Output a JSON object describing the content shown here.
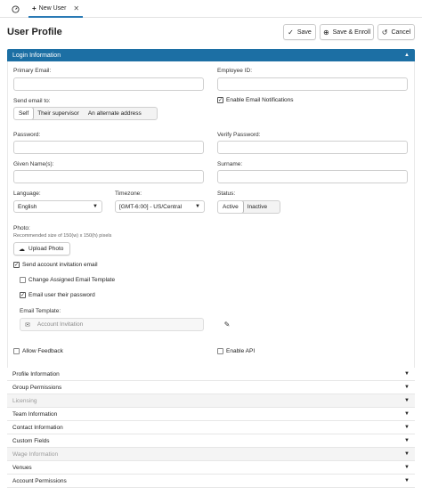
{
  "tabs": {
    "home_icon": "dashboard-icon",
    "active_label": "New User",
    "active_prefix": "+",
    "close_symbol": "✕"
  },
  "page": {
    "title": "User Profile"
  },
  "toolbar": {
    "save_label": "Save",
    "save_enroll_label": "Save & Enroll",
    "cancel_label": "Cancel"
  },
  "login": {
    "section_label": "Login Information",
    "primary_email_label": "Primary Email:",
    "primary_email_value": "",
    "employee_id_label": "Employee ID:",
    "employee_id_value": "",
    "send_email_label": "Send email to:",
    "send_email_options": [
      "Self",
      "Their supervisor",
      "An alternate address"
    ],
    "send_email_selected": "Self",
    "enable_notifications_label": "Enable Email Notifications",
    "enable_notifications_checked": true,
    "password_label": "Password:",
    "verify_password_label": "Verify Password:",
    "given_names_label": "Given Name(s):",
    "surname_label": "Surname:",
    "language_label": "Language:",
    "language_value": "English",
    "timezone_label": "Timezone:",
    "timezone_value": "[GMT-6:00] - US/Central",
    "status_label": "Status:",
    "status_options": [
      "Active",
      "Inactive"
    ],
    "status_selected": "Active",
    "photo_label": "Photo:",
    "photo_hint": "Recommended size of 150(w) x 150(h) pixels",
    "upload_label": "Upload Photo",
    "send_invitation_label": "Send account invitation email",
    "send_invitation_checked": true,
    "change_template_label": "Change Assigned Email Template",
    "change_template_checked": false,
    "email_password_label": "Email user their password",
    "email_password_checked": true,
    "email_template_label": "Email Template:",
    "email_template_value": "Account Invitation",
    "allow_feedback_label": "Allow Feedback",
    "allow_feedback_checked": false,
    "enable_api_label": "Enable API",
    "enable_api_checked": false
  },
  "sections": [
    {
      "label": "Profile Information",
      "dim": false
    },
    {
      "label": "Group Permissions",
      "dim": false
    },
    {
      "label": "Licensing",
      "dim": true
    },
    {
      "label": "Team Information",
      "dim": false
    },
    {
      "label": "Contact Information",
      "dim": false
    },
    {
      "label": "Custom Fields",
      "dim": false
    },
    {
      "label": "Wage Information",
      "dim": true
    },
    {
      "label": "Venues",
      "dim": false
    },
    {
      "label": "Account Permissions",
      "dim": false
    }
  ],
  "colors": {
    "accent": "#1c6fa4",
    "tab_underline": "#2a7ab5"
  }
}
